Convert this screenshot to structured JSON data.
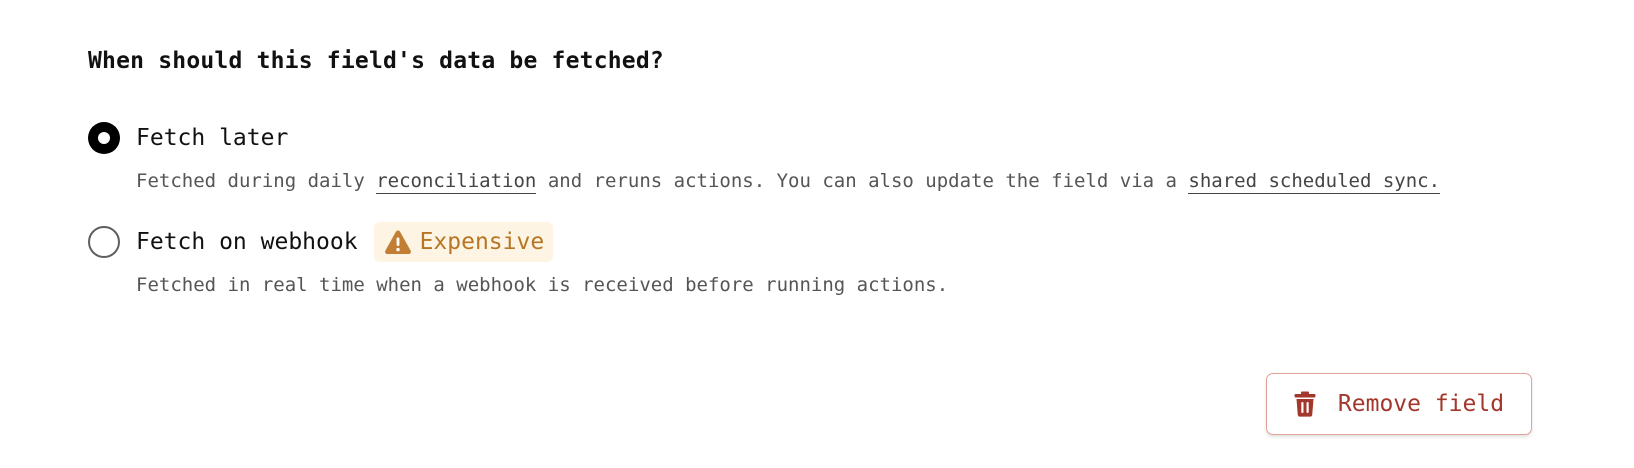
{
  "question": "When should this field's data be fetched?",
  "options": [
    {
      "label": "Fetch later",
      "selected": true,
      "description_prefix": "Fetched during daily ",
      "link1": "reconciliation",
      "description_mid": " and reruns actions. You can also update the field via a ",
      "link2": "shared scheduled sync."
    },
    {
      "label": "Fetch on webhook",
      "selected": false,
      "badge": "Expensive",
      "badge_icon": "warning-icon",
      "description": "Fetched in real time when a webhook is received before running actions."
    }
  ],
  "remove_button": {
    "label": "Remove field",
    "icon": "trash-icon"
  },
  "colors": {
    "badge_bg": "#fdf4e3",
    "badge_text": "#b87625",
    "danger": "#a3372b",
    "danger_border": "#e3a296"
  }
}
